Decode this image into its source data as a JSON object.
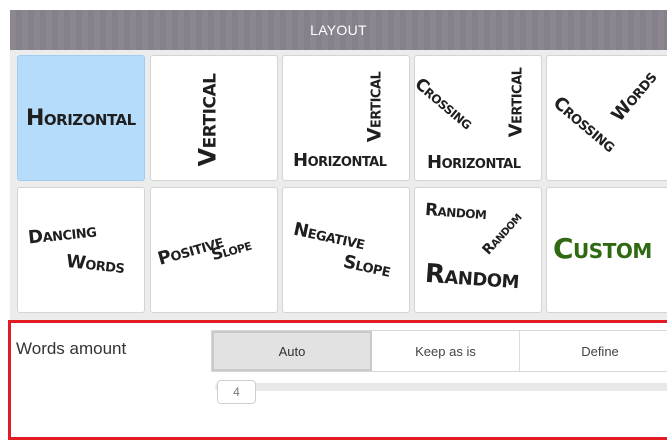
{
  "header": {
    "title": "LAYOUT"
  },
  "layouts": [
    {
      "id": "horizontal",
      "selected": true,
      "words": [
        "Horizontal"
      ]
    },
    {
      "id": "vertical",
      "selected": false,
      "words": [
        "Vertical"
      ]
    },
    {
      "id": "vertical-horizontal",
      "selected": false,
      "words": [
        "Vertical",
        "Horizontal"
      ]
    },
    {
      "id": "crossing-vertical-horizontal",
      "selected": false,
      "words": [
        "Crossing",
        "Vertical",
        "Horizontal"
      ]
    },
    {
      "id": "crossing-words",
      "selected": false,
      "words": [
        "Crossing",
        "Words"
      ]
    },
    {
      "id": "dancing-words",
      "selected": false,
      "words": [
        "Dancing",
        "Words"
      ]
    },
    {
      "id": "positive-slope",
      "selected": false,
      "words": [
        "Positive",
        "Slope"
      ]
    },
    {
      "id": "negative-slope",
      "selected": false,
      "words": [
        "Negative",
        "Slope"
      ]
    },
    {
      "id": "random",
      "selected": false,
      "words": [
        "Random",
        "Random",
        "Random"
      ]
    },
    {
      "id": "custom",
      "selected": false,
      "words": [
        "Custom"
      ]
    }
  ],
  "words_amount": {
    "label": "Words amount",
    "options": [
      "Auto",
      "Keep as is",
      "Define"
    ],
    "selected": "Auto",
    "slider_value": "4"
  },
  "colors": {
    "header_bg": "#86808a",
    "selected_tile": "#b6dcfb",
    "custom_text": "#2f6a12",
    "highlight_border": "#e01b24"
  }
}
